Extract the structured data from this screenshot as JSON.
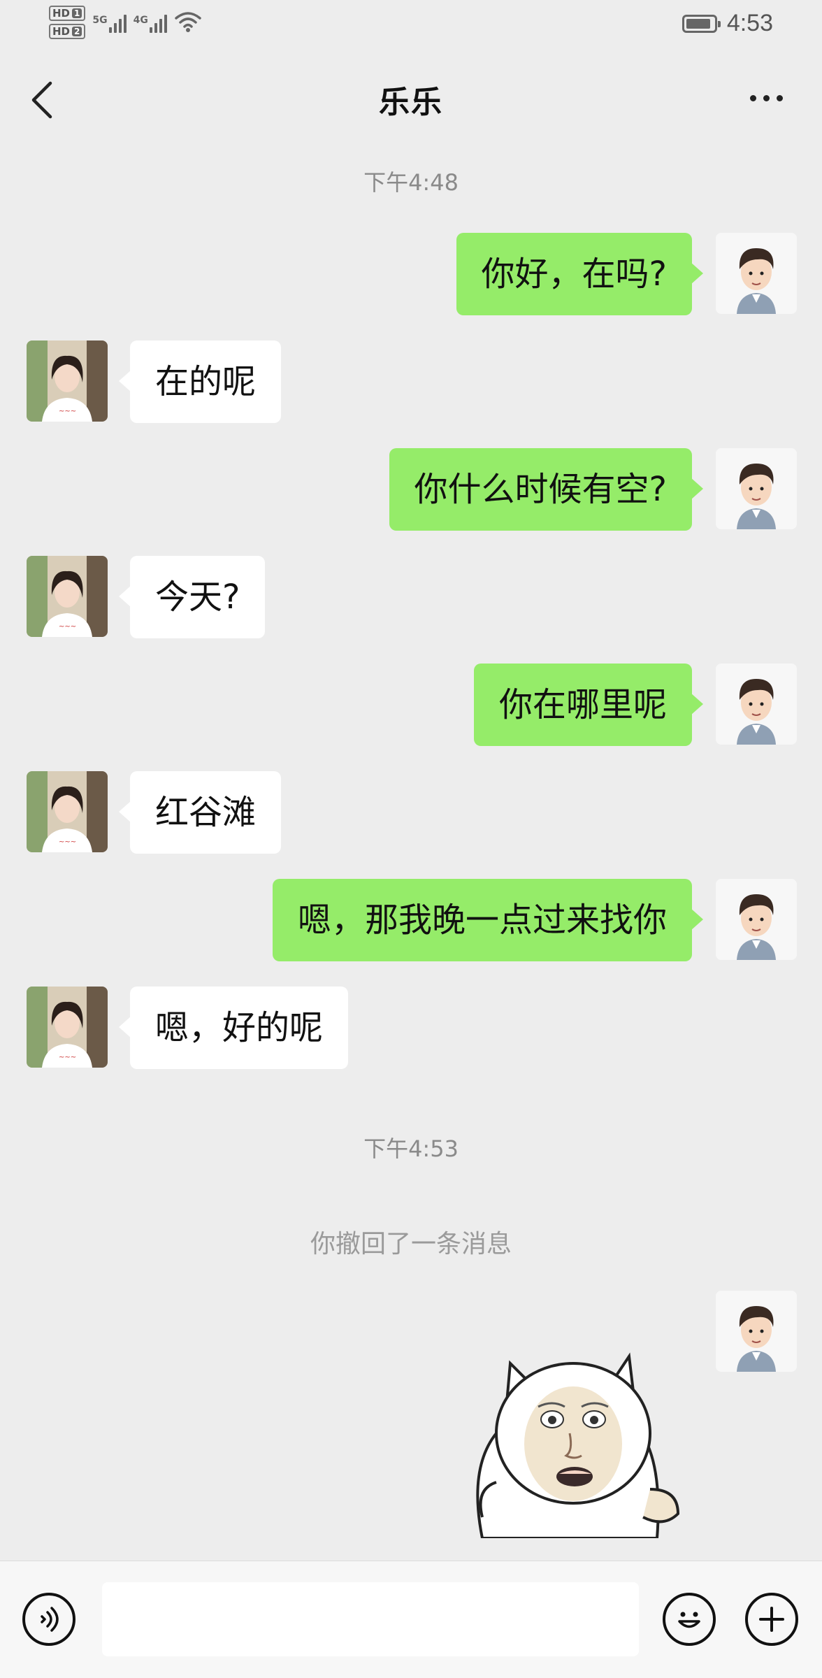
{
  "status_bar": {
    "sim1": "HD",
    "sim1_slot": "1",
    "sim2": "HD",
    "sim2_slot": "2",
    "net1": "5G",
    "net2": "4G",
    "time": "4:53"
  },
  "header": {
    "title": "乐乐"
  },
  "chat": {
    "timestamp1": "下午4:48",
    "messages": [
      {
        "from": "me",
        "text": "你好，在吗?"
      },
      {
        "from": "her",
        "text": "在的呢"
      },
      {
        "from": "me",
        "text": "你什么时候有空?"
      },
      {
        "from": "her",
        "text": "今天?"
      },
      {
        "from": "me",
        "text": "你在哪里呢"
      },
      {
        "from": "her",
        "text": "红谷滩"
      },
      {
        "from": "me",
        "text": "嗯，那我晚一点过来找你"
      },
      {
        "from": "her",
        "text": "嗯，好的呢"
      }
    ],
    "timestamp2": "下午4:53",
    "recall_notice": "你撤回了一条消息",
    "sticker": "cat-face-sticker"
  },
  "input_bar": {
    "voice_icon": "voice-icon",
    "emoji_icon": "emoji-icon",
    "plus_icon": "plus-icon",
    "input_value": ""
  },
  "colors": {
    "background": "#ededed",
    "my_bubble": "#95ec69",
    "her_bubble": "#ffffff"
  }
}
